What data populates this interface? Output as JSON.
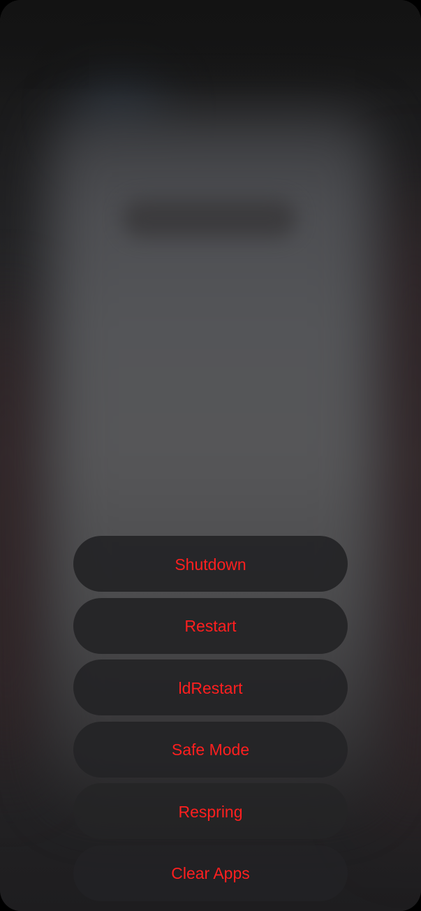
{
  "power_menu": {
    "accent_color": "#ff1f1f",
    "items": [
      {
        "label": "Shutdown"
      },
      {
        "label": "Restart"
      },
      {
        "label": "ldRestart"
      },
      {
        "label": "Safe Mode"
      },
      {
        "label": "Respring"
      },
      {
        "label": "Clear Apps"
      }
    ]
  }
}
